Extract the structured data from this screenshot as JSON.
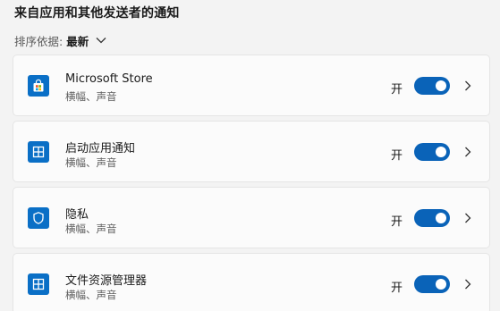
{
  "section": {
    "title": "来自应用和其他发送者的通知"
  },
  "sort": {
    "label": "排序依据:",
    "value": "最新",
    "icon": "chevron-down-icon"
  },
  "apps": [
    {
      "name": "Microsoft Store",
      "subtitle": "横幅、声音",
      "state": "开",
      "enabled": true,
      "icon": "store-icon"
    },
    {
      "name": "启动应用通知",
      "subtitle": "横幅、声音",
      "state": "开",
      "enabled": true,
      "icon": "app-window-icon"
    },
    {
      "name": "隐私",
      "subtitle": "横幅、声音",
      "state": "开",
      "enabled": true,
      "icon": "shield-icon"
    },
    {
      "name": "文件资源管理器",
      "subtitle": "横幅、声音",
      "state": "开",
      "enabled": true,
      "icon": "app-window-icon"
    }
  ],
  "colors": {
    "accent": "#0a63b8",
    "icon_bg": "#0a6fc6",
    "background": "#f3f3f3",
    "card": "#fbfbfb"
  }
}
